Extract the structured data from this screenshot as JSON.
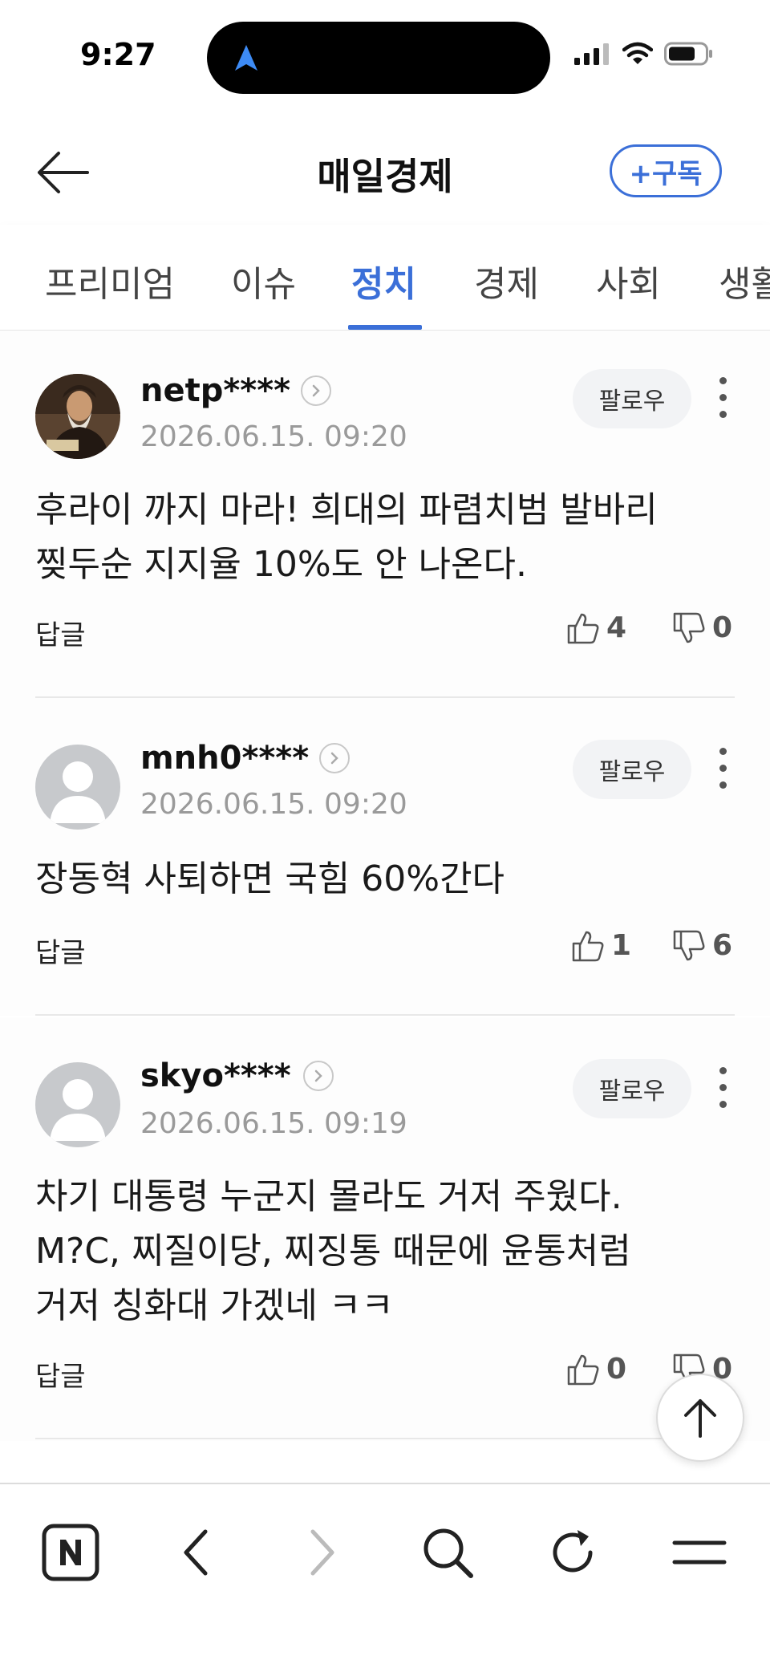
{
  "status": {
    "time": "9:27"
  },
  "header": {
    "title": "매일경제",
    "subscribe_label": "+구독"
  },
  "tabs": [
    {
      "label": "프리미엄",
      "active": false
    },
    {
      "label": "이슈",
      "active": false
    },
    {
      "label": "정치",
      "active": true
    },
    {
      "label": "경제",
      "active": false
    },
    {
      "label": "사회",
      "active": false
    },
    {
      "label": "생활",
      "active": false
    }
  ],
  "comments": [
    {
      "username": "netp****",
      "timestamp": "2026.06.15. 09:20",
      "follow_label": "팔로우",
      "body": [
        "후라이 까지 마라! 희대의 파렴치범 발바리",
        "찢두순 지지율 10%도 안 나온다."
      ],
      "reply_label": "답글",
      "likes": "4",
      "dislikes": "0",
      "avatar": "portrait-avatar"
    },
    {
      "username": "mnh0****",
      "timestamp": "2026.06.15. 09:20",
      "follow_label": "팔로우",
      "body": [
        "장동혁 사퇴하면 국힘 60%간다"
      ],
      "reply_label": "답글",
      "likes": "1",
      "dislikes": "6",
      "avatar": "default-avatar"
    },
    {
      "username": "skyo****",
      "timestamp": "2026.06.15. 09:19",
      "follow_label": "팔로우",
      "body": [
        "차기 대통령 누군지 몰라도 거저 주웠다.",
        "M?C, 찌질이당, 찌징통 때문에 윤통처럼",
        "거저 칭화대 가겠네 ㅋㅋ"
      ],
      "reply_label": "답글",
      "likes": "0",
      "dislikes": "0",
      "avatar": "default-avatar"
    }
  ],
  "colors": {
    "accent": "#3b6fd8",
    "muted_text": "#9a9a9a",
    "follow_bg": "#f2f3f5"
  },
  "bottom_nav": [
    "naver-home-icon",
    "back-icon",
    "forward-icon",
    "search-icon",
    "reload-icon",
    "menu-icon"
  ]
}
